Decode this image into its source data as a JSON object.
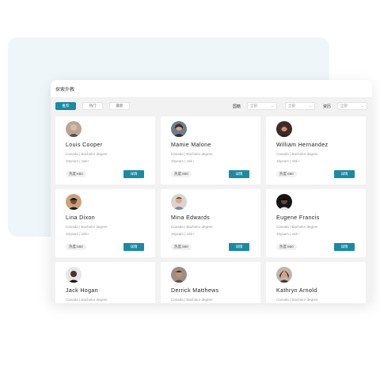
{
  "window": {
    "title": "探索外教"
  },
  "tabs": [
    {
      "label": "推荐",
      "active": true
    },
    {
      "label": "热门",
      "active": false
    },
    {
      "label": "最新",
      "active": false
    }
  ],
  "filters": {
    "nationality_label": "国籍",
    "nationality_options": [
      {
        "value": "全部"
      },
      {
        "value": "全部"
      }
    ],
    "qualification_label": "资历",
    "qualification_value": "全部"
  },
  "teachers": [
    {
      "name": "Louis Cooper",
      "meta": "Canada | Bachelor degree",
      "meta2": "10years | 16k+",
      "heat": "热度:660",
      "action": "详情"
    },
    {
      "name": "Mamie Malone",
      "meta": "Canada | Bachelor degree",
      "meta2": "10years | 16k+",
      "heat": "热度:660",
      "action": "详情"
    },
    {
      "name": "William Hernandez",
      "meta": "Canada | Bachelor degree",
      "meta2": "10years | 16k+",
      "heat": "热度:660",
      "action": "详情"
    },
    {
      "name": "Lina Dixon",
      "meta": "Canada | Bachelor degree",
      "meta2": "10years | 16k+",
      "heat": "热度:660",
      "action": "详情"
    },
    {
      "name": "Mina Edwards",
      "meta": "Canada | Bachelor degree",
      "meta2": "10years | 16k+",
      "heat": "热度:660",
      "action": "详情"
    },
    {
      "name": "Eugene Francis",
      "meta": "Canada | Bachelor degree",
      "meta2": "10years | 16k+",
      "heat": "热度:660",
      "action": "详情"
    },
    {
      "name": "Jack Hogan",
      "meta": "Canada | Bachelor degree",
      "meta2": "",
      "heat": "",
      "action": ""
    },
    {
      "name": "Derrick Matthews",
      "meta": "Canada | Bachelor degree",
      "meta2": "",
      "heat": "",
      "action": ""
    },
    {
      "name": "Kathryn Arnold",
      "meta": "Canada | Bachelor degree",
      "meta2": "",
      "heat": "",
      "action": ""
    }
  ],
  "colors": {
    "accent": "#1b8aa3",
    "backdrop": "#eef6f9"
  }
}
